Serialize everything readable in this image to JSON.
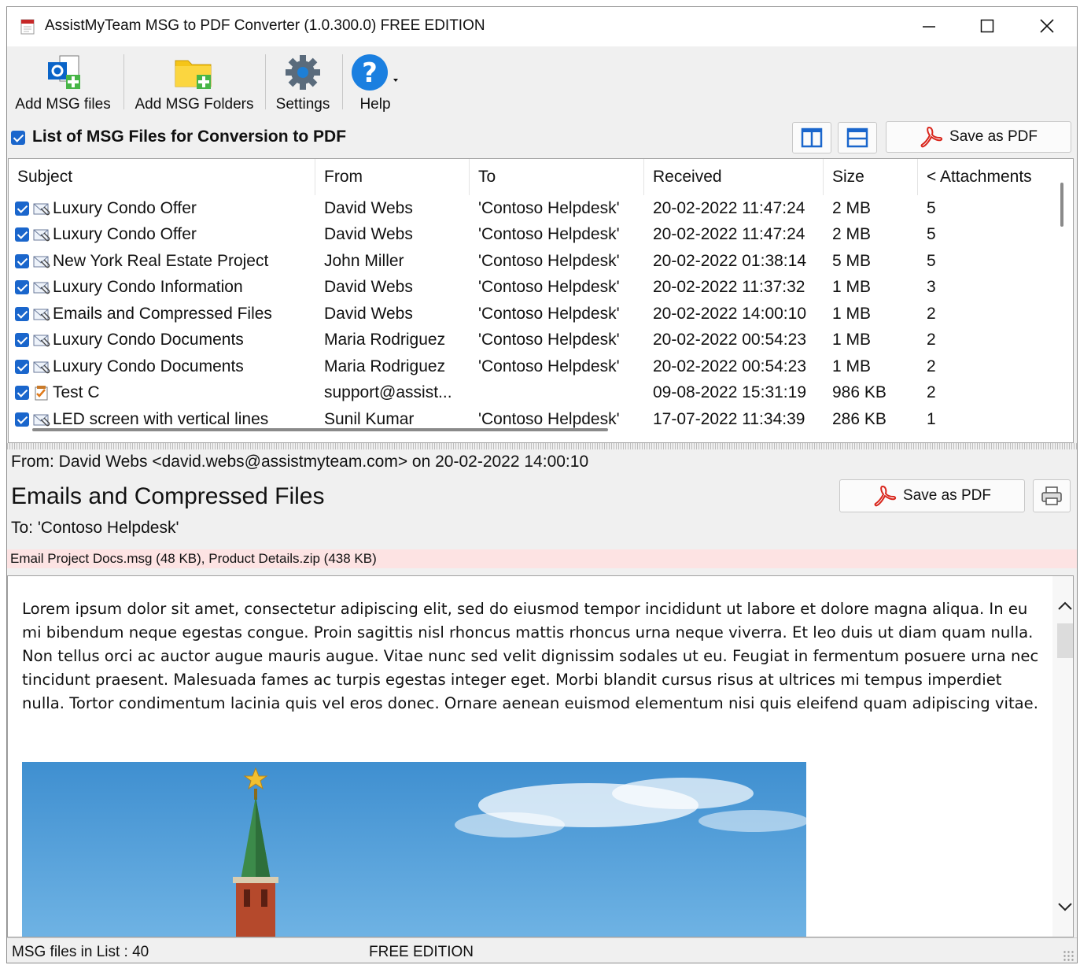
{
  "window": {
    "title": "AssistMyTeam MSG to PDF Converter (1.0.300.0) FREE EDITION"
  },
  "toolbar": {
    "add_files": "Add MSG files",
    "add_folders": "Add MSG Folders",
    "settings": "Settings",
    "help": "Help"
  },
  "list": {
    "title": "List of MSG Files for Conversion to PDF",
    "save_pdf": "Save as PDF",
    "columns": [
      "Subject",
      "From",
      "To",
      "Received",
      "Size",
      "< Attachments"
    ],
    "rows": [
      {
        "subject": "Luxury Condo Offer",
        "from": "David Webs",
        "to": "'Contoso Helpdesk'",
        "received": "20-02-2022 11:47:24",
        "size": "2 MB",
        "attachments": "5",
        "icon": "mail-attachment-icon"
      },
      {
        "subject": "Luxury Condo Offer",
        "from": "David Webs",
        "to": "'Contoso Helpdesk'",
        "received": "20-02-2022 11:47:24",
        "size": "2 MB",
        "attachments": "5",
        "icon": "mail-attachment-icon"
      },
      {
        "subject": "New York Real Estate Project",
        "from": "John Miller",
        "to": "'Contoso Helpdesk'",
        "received": "20-02-2022 01:38:14",
        "size": "5 MB",
        "attachments": "5",
        "icon": "mail-attachment-icon"
      },
      {
        "subject": "Luxury Condo Information",
        "from": "David Webs",
        "to": "'Contoso Helpdesk'",
        "received": "20-02-2022 11:37:32",
        "size": "1 MB",
        "attachments": "3",
        "icon": "mail-attachment-icon"
      },
      {
        "subject": "Emails and Compressed Files",
        "from": "David Webs",
        "to": "'Contoso Helpdesk'",
        "received": "20-02-2022 14:00:10",
        "size": "1 MB",
        "attachments": "2",
        "icon": "mail-attachment-icon"
      },
      {
        "subject": "Luxury Condo Documents",
        "from": "Maria Rodriguez",
        "to": "'Contoso Helpdesk'",
        "received": "20-02-2022 00:54:23",
        "size": "1 MB",
        "attachments": "2",
        "icon": "mail-attachment-icon"
      },
      {
        "subject": "Luxury Condo Documents",
        "from": "Maria Rodriguez",
        "to": "'Contoso Helpdesk'",
        "received": "20-02-2022 00:54:23",
        "size": "1 MB",
        "attachments": "2",
        "icon": "mail-attachment-icon"
      },
      {
        "subject": "Test C",
        "from": "support@assist...",
        "to": "",
        "received": "09-08-2022 15:31:19",
        "size": "986 KB",
        "attachments": "2",
        "icon": "task-icon"
      },
      {
        "subject": "LED screen with vertical lines",
        "from": "Sunil Kumar",
        "to": "'Contoso Helpdesk'",
        "received": "17-07-2022 11:34:39",
        "size": "286 KB",
        "attachments": "1",
        "icon": "mail-attachment-icon"
      }
    ]
  },
  "preview": {
    "from_line": "From: David Webs <david.webs@assistmyteam.com> on 20-02-2022 14:00:10",
    "subject": "Emails and Compressed Files",
    "to_line": "To: 'Contoso Helpdesk'",
    "attachments": "Email Project Docs.msg (48 KB), Product Details.zip (438 KB)",
    "save_pdf": "Save as PDF",
    "body": "Lorem ipsum dolor sit amet, consectetur adipiscing elit, sed do eiusmod tempor incididunt ut labore et dolore magna aliqua. In eu mi bibendum neque egestas congue. Proin sagittis nisl rhoncus mattis rhoncus urna neque viverra. Et leo duis ut diam quam nulla. Non tellus orci ac auctor augue mauris augue. Vitae nunc sed velit dignissim sodales ut eu. Feugiat in fermentum posuere urna nec tincidunt praesent. Malesuada fames ac turpis egestas integer eget. Morbi blandit cursus risus at ultrices mi tempus imperdiet nulla. Tortor condimentum lacinia quis vel eros donec. Ornare aenean euismod elementum nisi quis eleifend quam adipiscing vitae."
  },
  "status": {
    "count": "MSG files in List : 40",
    "edition": "FREE EDITION"
  }
}
